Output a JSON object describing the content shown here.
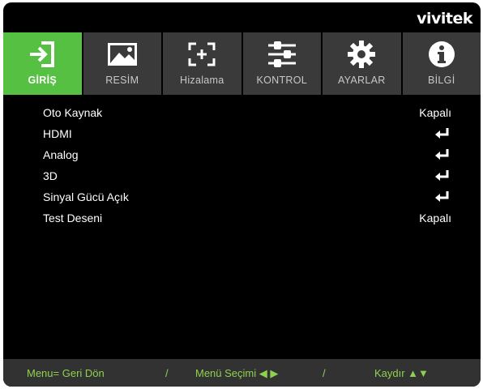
{
  "brand": "vivitek",
  "tabs": [
    {
      "label": "GİRİŞ",
      "icon": "input-icon",
      "active": true
    },
    {
      "label": "RESİM",
      "icon": "image-icon",
      "active": false
    },
    {
      "label": "Hizalama",
      "icon": "alignment-icon",
      "active": false
    },
    {
      "label": "KONTROL",
      "icon": "sliders-icon",
      "active": false
    },
    {
      "label": "AYARLAR",
      "icon": "gear-icon",
      "active": false
    },
    {
      "label": "BİLGİ",
      "icon": "info-icon",
      "active": false
    }
  ],
  "items": [
    {
      "label": "Oto Kaynak",
      "value": "Kapalı"
    },
    {
      "label": "HDMI",
      "value": null,
      "icon": "enter-icon"
    },
    {
      "label": "Analog",
      "value": null,
      "icon": "enter-icon"
    },
    {
      "label": "3D",
      "value": null,
      "icon": "enter-icon"
    },
    {
      "label": "Sinyal Gücü Açık",
      "value": null,
      "icon": "enter-icon"
    },
    {
      "label": "Test Deseni",
      "value": "Kapalı"
    }
  ],
  "footer": {
    "back": "Menu= Geri Dön",
    "sep1": "/",
    "select": "Menü Seçimi ◀ ▶",
    "sep2": "/",
    "scroll": "Kaydır ▲▼"
  },
  "colors": {
    "active_tab": "#55c041",
    "tab_bg": "#3a3a3a",
    "footer_text": "#8fd14f",
    "background": "#000000"
  }
}
